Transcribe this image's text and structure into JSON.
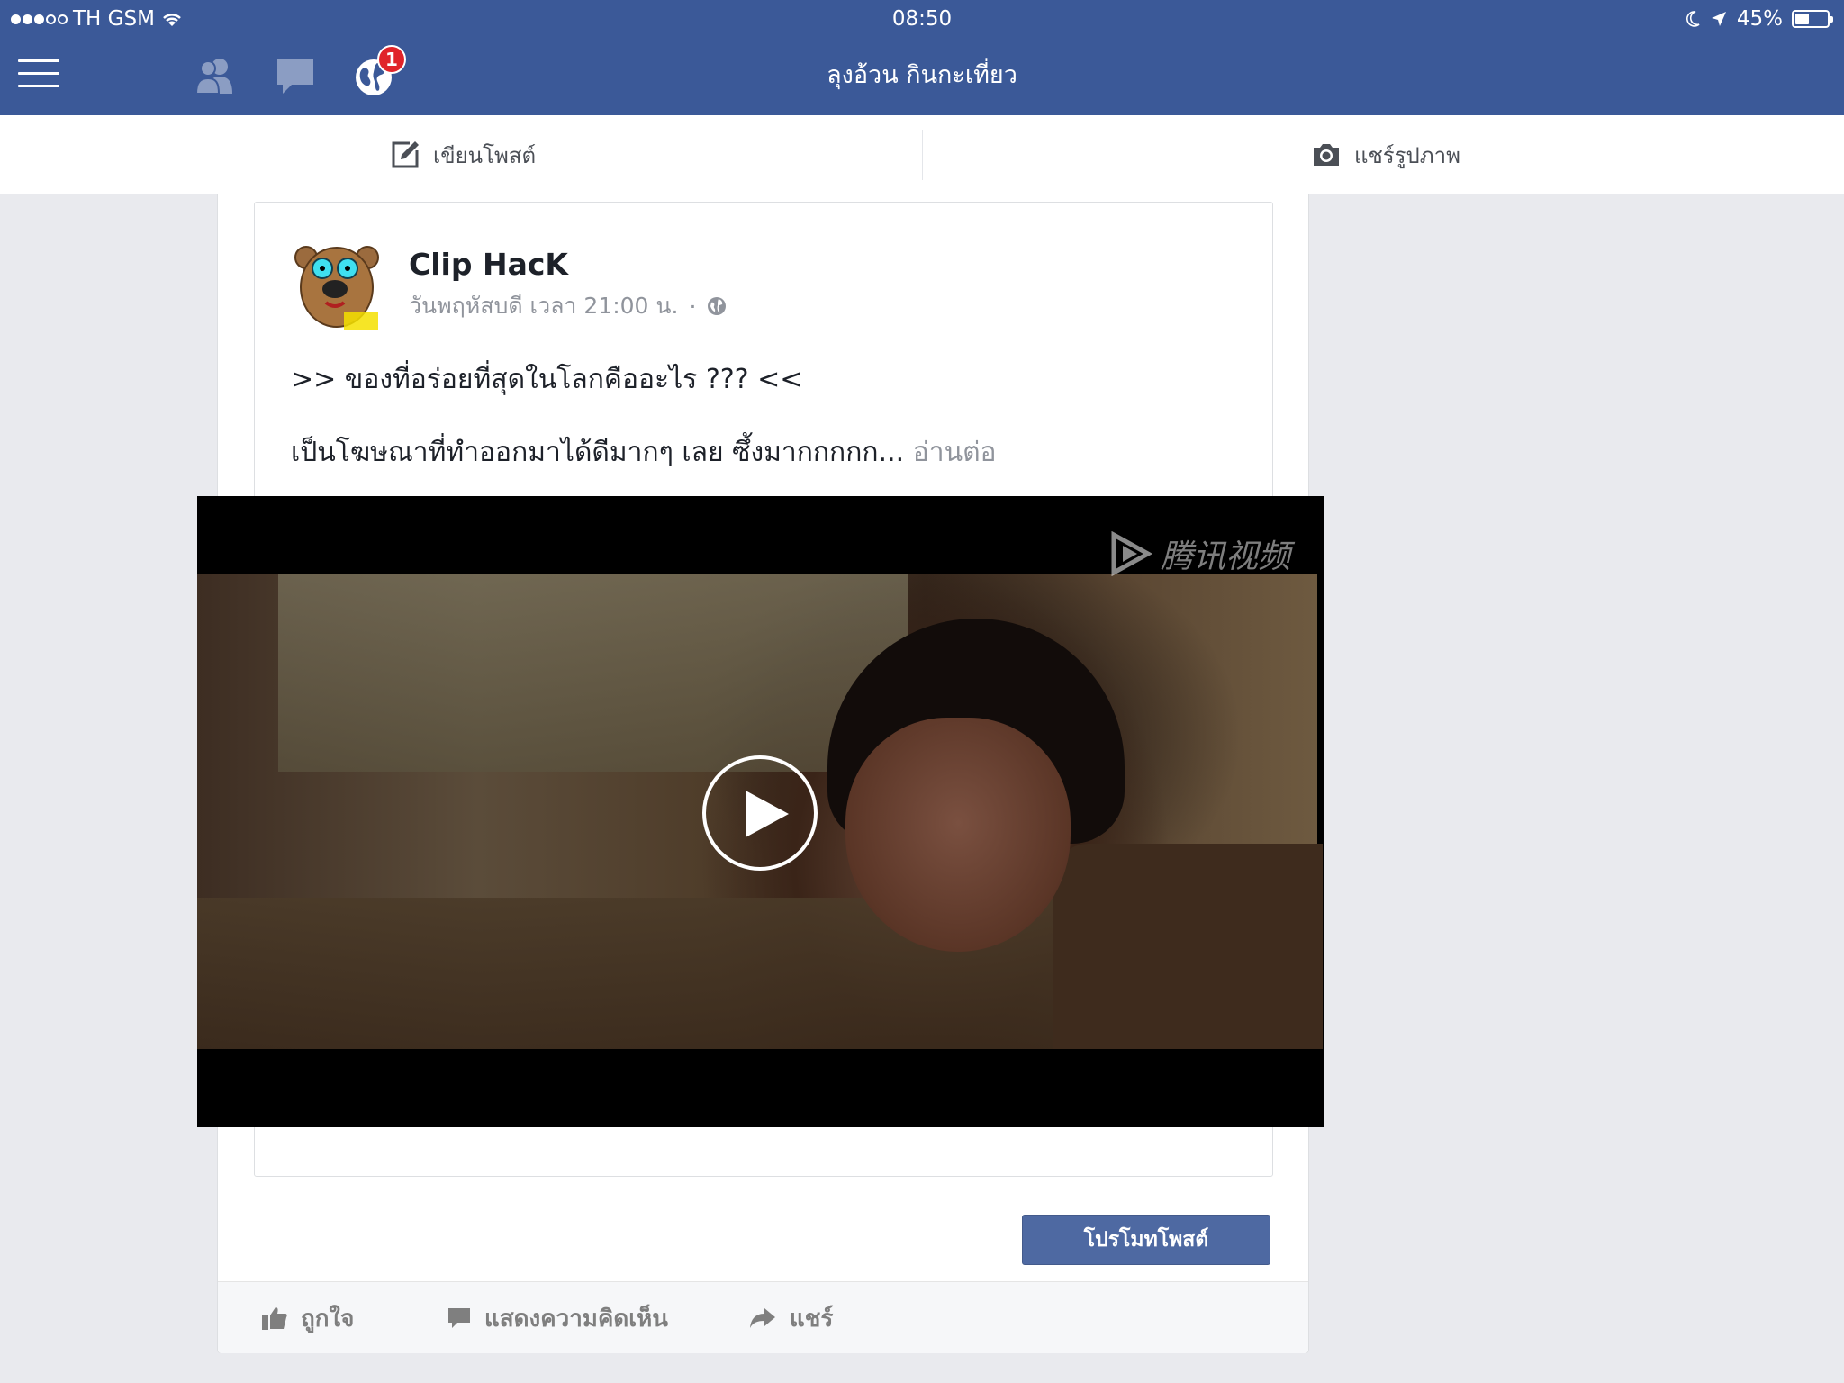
{
  "status_bar": {
    "carrier": "TH GSM",
    "time": "08:50",
    "battery": "45%",
    "battery_level": 0.45
  },
  "nav": {
    "notification_count": "1",
    "page_name": "ลุงอ้วน กินกะเที่ยว"
  },
  "action_bar": {
    "write_label": "เขียนโพสต์",
    "photo_label": "แชร์รูปภาพ"
  },
  "post": {
    "author": "Clip HacK",
    "timestamp": "วันพฤหัสบดี เวลา 21:00 น.",
    "separator": "·",
    "line1": ">> ของที่อร่อยที่สุดในโลกคืออะไร ??? <<",
    "line2": "เป็นโฆษณาที่ทำออกมาได้ดีมากๆ เลย ซึ้งมากกกกก...",
    "see_more": "อ่านต่อ",
    "video_watermark": "腾讯视频",
    "promote_label": "โปรโมทโพสต์"
  },
  "footer": {
    "like": "ถูกใจ",
    "comment": "แสดงความคิดเห็น",
    "share": "แชร์"
  }
}
